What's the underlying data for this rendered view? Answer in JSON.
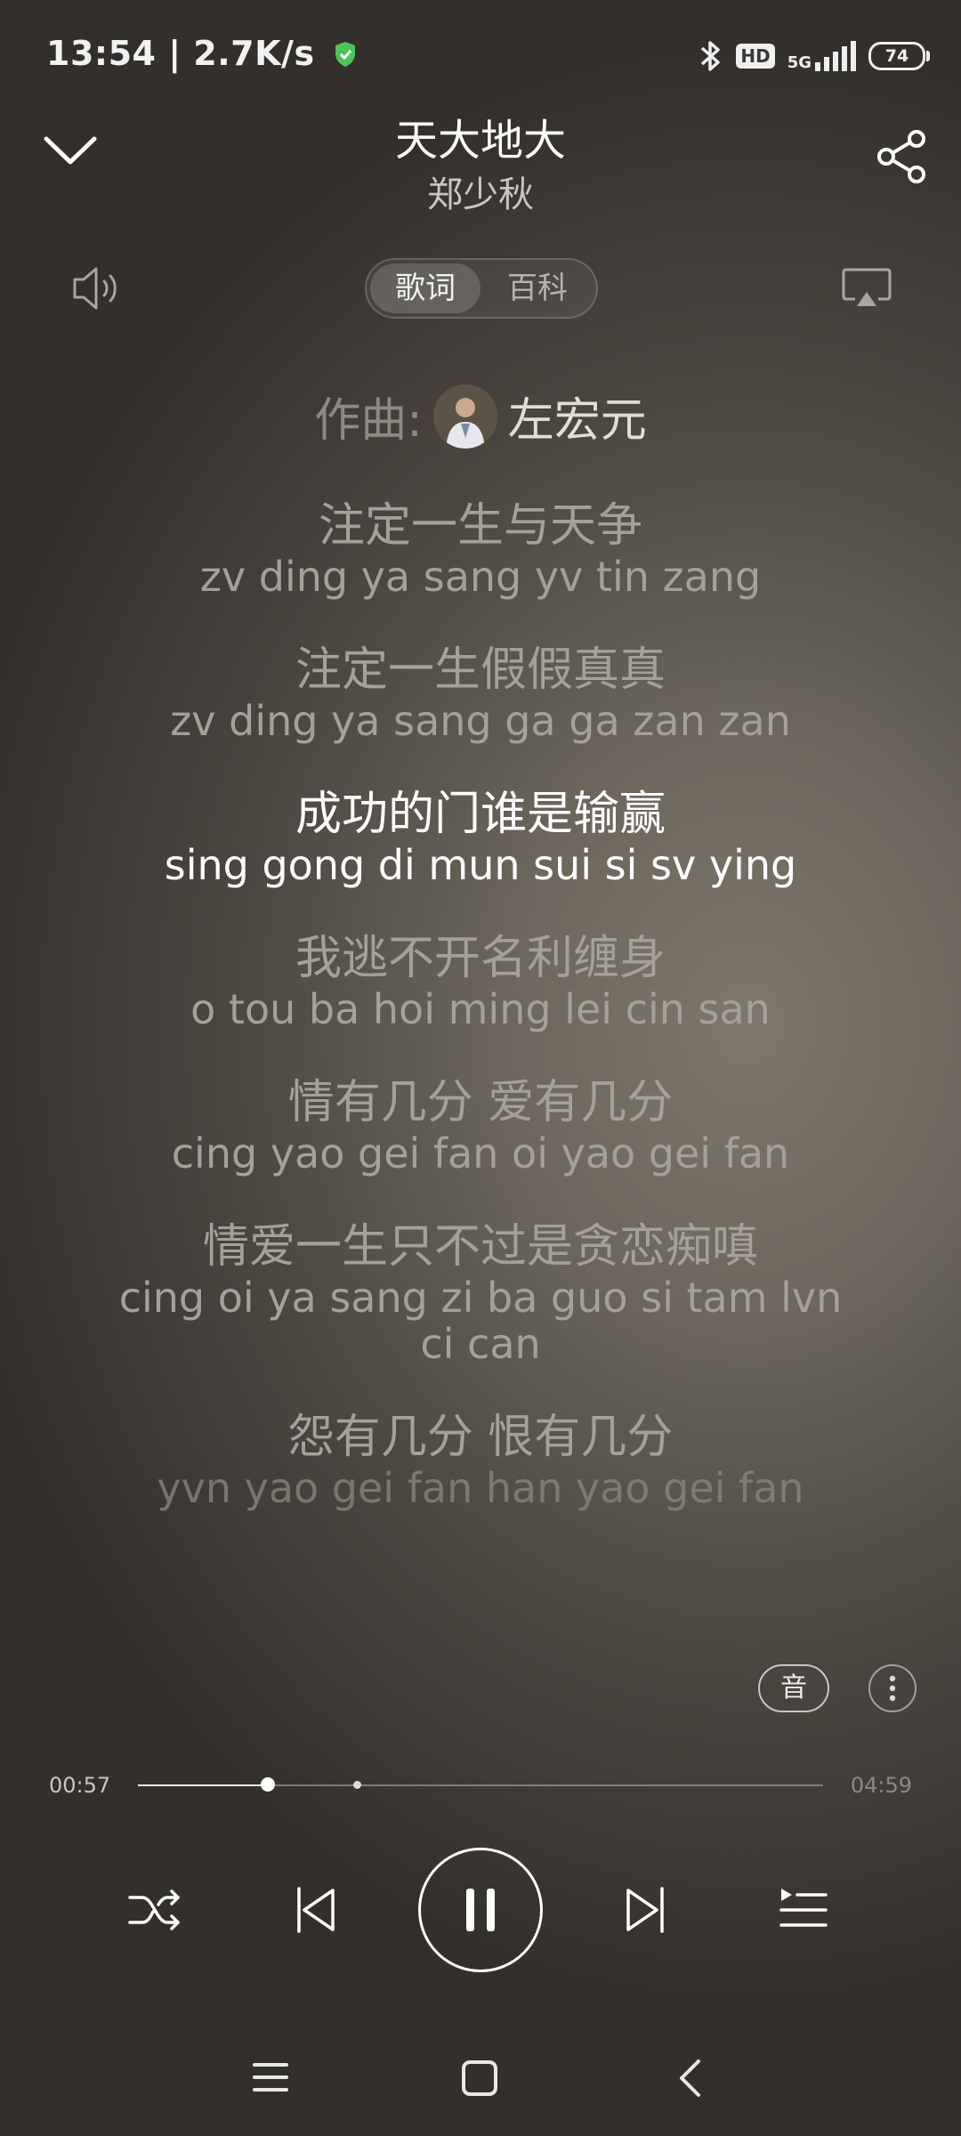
{
  "status_bar": {
    "time_speed": "13:54 | 2.7K/s",
    "hd": "HD",
    "network": "5G",
    "battery": "74"
  },
  "header": {
    "title": "天大地大",
    "artist": "郑少秋"
  },
  "tabs": [
    {
      "label": "歌词",
      "active": true
    },
    {
      "label": "百科",
      "active": false
    }
  ],
  "credit": {
    "label": "作曲:",
    "name": "左宏元"
  },
  "lyrics": [
    {
      "cn": "注定一生与天争",
      "py": "zv ding ya sang yv tin zang",
      "state": "normal"
    },
    {
      "cn": "注定一生假假真真",
      "py": "zv ding ya sang ga ga zan zan",
      "state": "normal"
    },
    {
      "cn": "成功的门谁是输赢",
      "py": "sing gong di mun sui si sv ying",
      "state": "active"
    },
    {
      "cn": "我逃不开名利缠身",
      "py": "o tou ba hoi ming lei cin san",
      "state": "normal"
    },
    {
      "cn": "情有几分 爱有几分",
      "py": "cing yao gei fan oi yao gei fan",
      "state": "normal"
    },
    {
      "cn": "情爱一生只不过是贪恋痴嗔",
      "py": "cing oi ya sang zi ba guo si tam lvn ci can",
      "state": "normal"
    },
    {
      "cn": "怨有几分 恨有几分",
      "py": "yvn yao gei fan han yao gei fan",
      "state": "fade"
    }
  ],
  "actions": {
    "sound_label": "音"
  },
  "progress": {
    "current": "00:57",
    "total": "04:59",
    "played_fraction": 0.19,
    "buffered_fraction": 0.32
  },
  "icons": {
    "collapse": "chevron-down-icon",
    "share": "share-icon",
    "volume": "volume-icon",
    "cast": "cast-icon",
    "shuffle": "shuffle-icon",
    "previous": "previous-icon",
    "pause": "pause-icon",
    "next": "next-icon",
    "playlist": "playlist-icon",
    "more": "more-vertical-icon"
  }
}
